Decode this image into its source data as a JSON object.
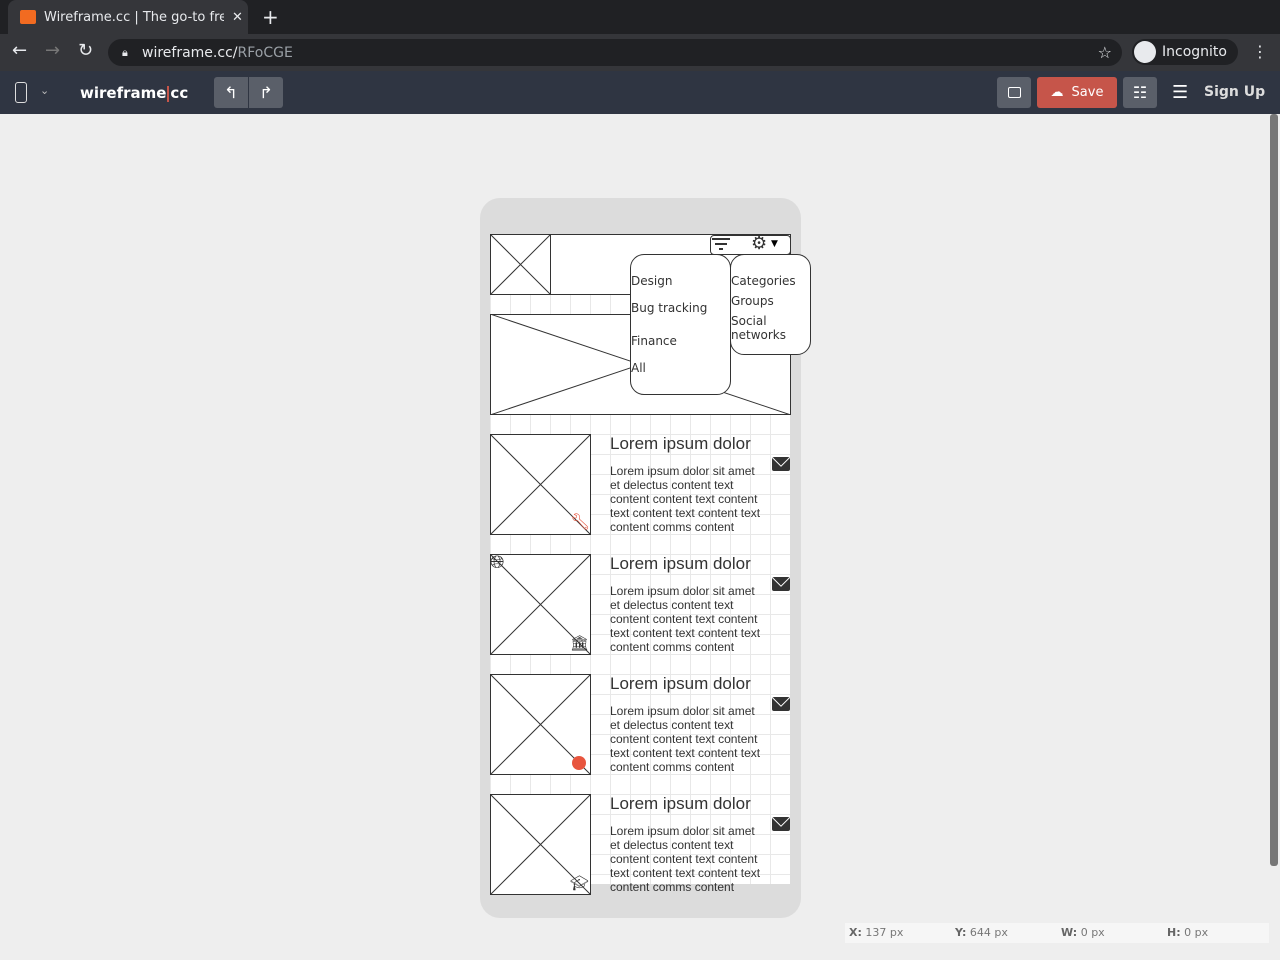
{
  "browser": {
    "tab_title": "Wireframe.cc | The go-to free",
    "url_host": "wireframe.cc/",
    "url_path": "RFoCGE",
    "profile": "Incognito"
  },
  "app": {
    "logo_left": "wireframe",
    "logo_right": "cc",
    "save_label": "Save",
    "signup_label": "Sign Up",
    "brand_color": "#c6554a"
  },
  "dropdown_left": [
    "Design",
    "Bug tracking",
    "Finance",
    "All"
  ],
  "dropdown_right": [
    "Categories",
    "Groups",
    "Social",
    "networks"
  ],
  "list": [
    {
      "title": "Lorem ipsum dolor",
      "lines": [
        "Lorem ipsum dolor sit amet",
        "et delectus content text",
        "content content text content",
        "text content text content text",
        "content comms content"
      ],
      "icon": "wrench-icon"
    },
    {
      "title": "Lorem ipsum dolor",
      "lines": [
        "Lorem ipsum dolor sit amet",
        "et delectus content text",
        "content content text content",
        "text content text content text",
        "content comms content"
      ],
      "icon": "bank-icon"
    },
    {
      "title": "Lorem ipsum dolor",
      "lines": [
        "Lorem ipsum dolor sit amet",
        "et delectus content text",
        "content content text content",
        "text content text content text",
        "content comms content"
      ],
      "icon": "bug-icon"
    },
    {
      "title": "Lorem ipsum dolor",
      "lines": [
        "Lorem ipsum dolor sit amet",
        "et delectus content text",
        "content content text content",
        "text content text content text",
        "content comms content"
      ],
      "icon": "graduation-cap-icon"
    }
  ],
  "status": {
    "x_label": "X:",
    "x": "137 px",
    "y_label": "Y:",
    "y": "644 px",
    "w_label": "W:",
    "w": "0 px",
    "h_label": "H:",
    "h": "0 px"
  }
}
